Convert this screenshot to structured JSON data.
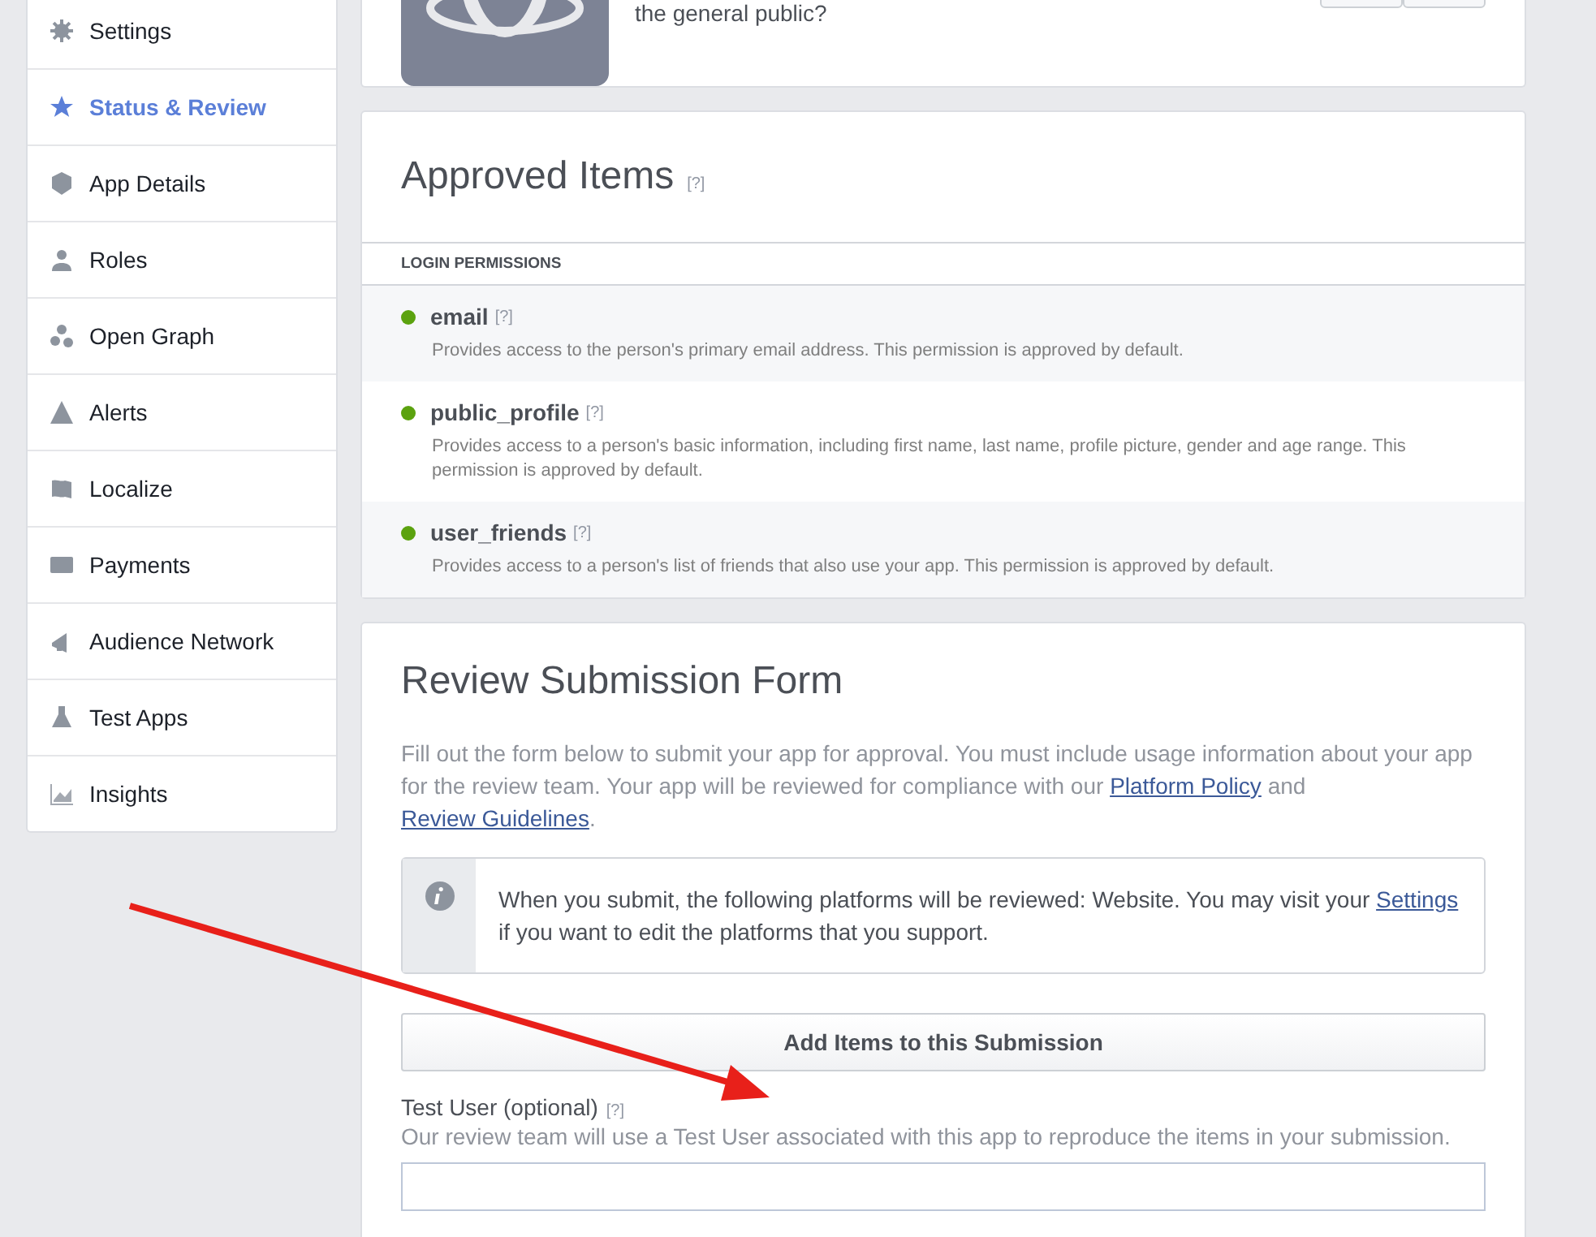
{
  "sidebar": {
    "items": [
      {
        "label": "Settings",
        "selected": false
      },
      {
        "label": "Status & Review",
        "selected": true
      },
      {
        "label": "App Details",
        "selected": false
      },
      {
        "label": "Roles",
        "selected": false
      },
      {
        "label": "Open Graph",
        "selected": false
      },
      {
        "label": "Alerts",
        "selected": false
      },
      {
        "label": "Localize",
        "selected": false
      },
      {
        "label": "Payments",
        "selected": false
      },
      {
        "label": "Audience Network",
        "selected": false
      },
      {
        "label": "Test Apps",
        "selected": false
      },
      {
        "label": "Insights",
        "selected": false
      }
    ]
  },
  "top_card": {
    "question": "the general public?"
  },
  "approved_items": {
    "title": "Approved Items",
    "help": "[?]",
    "section": "LOGIN PERMISSIONS",
    "permissions": [
      {
        "name": "email",
        "help": "[?]",
        "description": "Provides access to the person's primary email address. This permission is approved by default."
      },
      {
        "name": "public_profile",
        "help": "[?]",
        "description": "Provides access to a person's basic information, including first name, last name, profile picture, gender and age range. This permission is approved by default."
      },
      {
        "name": "user_friends",
        "help": "[?]",
        "description": "Provides access to a person's list of friends that also use your app. This permission is approved by default."
      }
    ]
  },
  "review_form": {
    "title": "Review Submission Form",
    "intro": [
      {
        "kind": "text",
        "text": "Fill out the form below to submit your app for approval. You must include usage information about your app for the review team. Your app will be reviewed for compliance with our"
      },
      {
        "kind": "link",
        "text": "Platform Policy"
      },
      {
        "kind": "text",
        "text": "and"
      },
      {
        "kind": "link",
        "text": "Review Guidelines"
      },
      {
        "kind": "text",
        "text": "."
      }
    ],
    "notice": [
      {
        "kind": "text",
        "text": "When you submit, the following platforms will be reviewed: Website. You may visit your"
      },
      {
        "kind": "link",
        "text": "Settings"
      },
      {
        "kind": "text",
        "text": "if you want to edit the platforms that you support."
      }
    ],
    "add_button": "Add Items to this Submission",
    "test_user": {
      "label": "Test User (optional)",
      "help": "[?]",
      "hint": "Our review team will use a Test User associated with this app to reproduce the items in your submission."
    }
  }
}
